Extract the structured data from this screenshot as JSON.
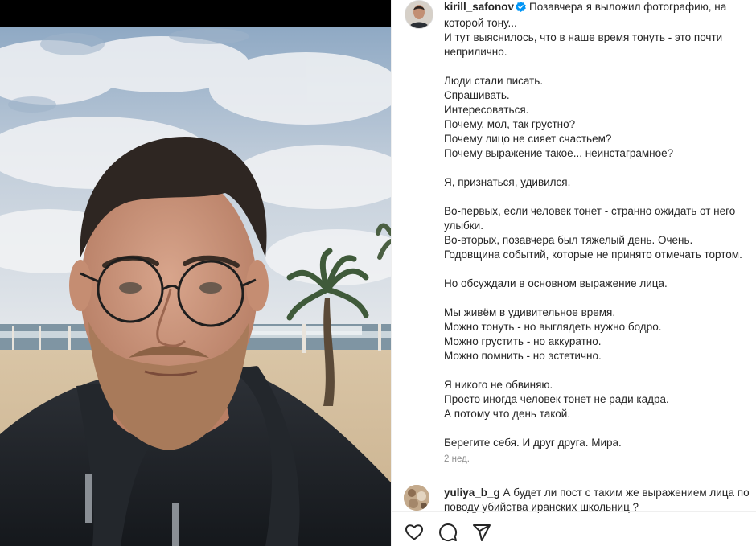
{
  "post": {
    "author": "kirill_safonov",
    "caption_first": "Позавчера я выложил фотографию, на которой тону...",
    "caption_lines": [
      "И тут выяснилось, что в наше время тонуть - это почти неприлично.",
      "",
      "Люди стали писать.",
      "Спрашивать.",
      "Интересоваться.",
      "Почему, мол, так грустно?",
      "Почему лицо не сияет счастьем?",
      "Почему выражение такое... неинстаграмное?",
      "",
      "Я, признаться, удивился.",
      "",
      "Во-первых, если человек тонет - странно ожидать от него улыбки.",
      "Во-вторых, позавчера был тяжелый день. Очень.",
      "Годовщина событий, которые не принято отмечать тортом.",
      "",
      "Но обсуждали в основном выражение лица.",
      "",
      "Мы живём в удивительное время.",
      "Можно тонуть - но выглядеть нужно бодро.",
      "Можно грустить - но аккуратно.",
      "Можно помнить - но эстетично.",
      "",
      "Я никого не обвиняю.",
      "Просто иногда человек тонет не ради кадра.",
      "А потому что день такой.",
      "",
      "Берегите себя. И друг друга. Мира."
    ],
    "time": "2 нед."
  },
  "comment": {
    "author": "yuliya_b_g",
    "text": "А будет ли пост с таким же выражением лица по поводу убийства иранских школьниц ?"
  },
  "icons": {
    "verified": "verified-badge-icon",
    "like": "heart-icon",
    "comment": "comment-bubble-icon",
    "share": "paper-plane-icon"
  },
  "colors": {
    "verified": "#0095f6",
    "text": "#262626",
    "muted": "#8e8e8e"
  }
}
